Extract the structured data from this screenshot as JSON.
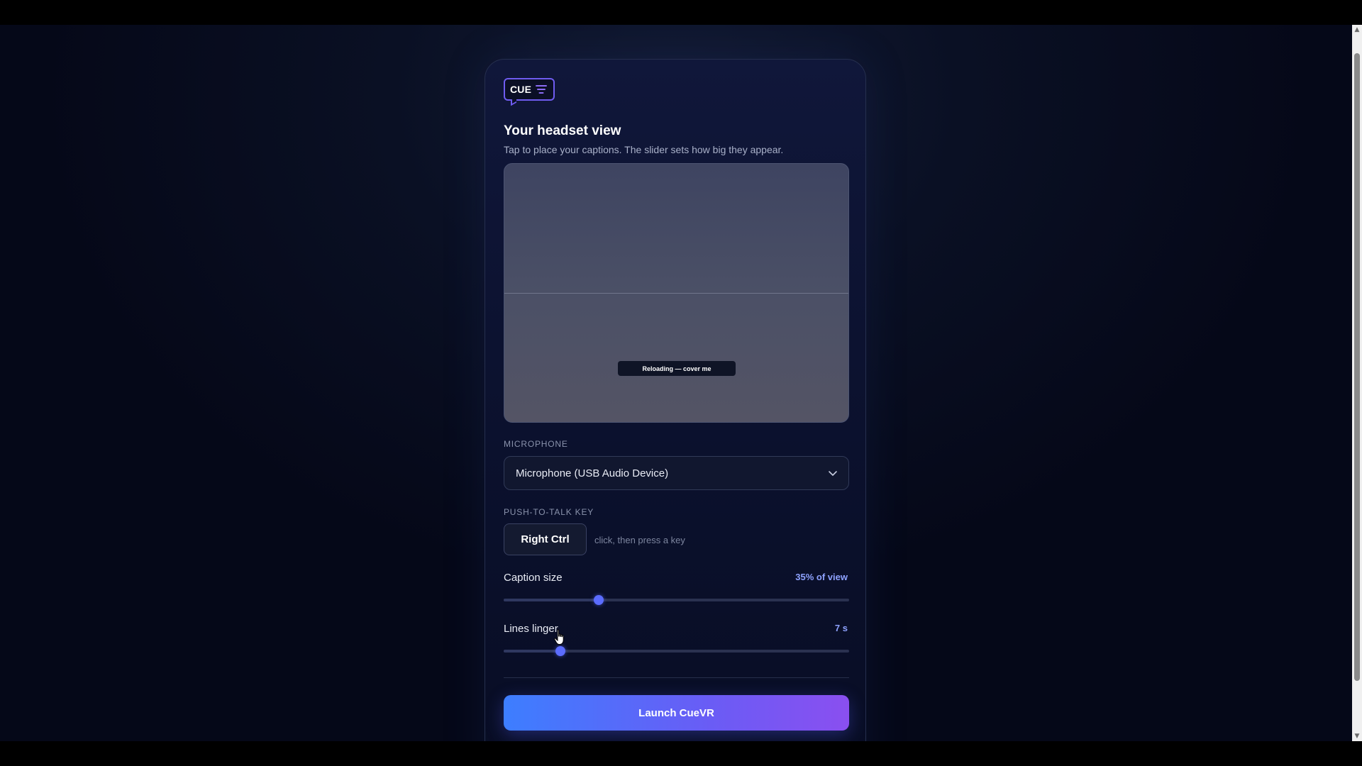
{
  "logo": {
    "text": "CUE",
    "icon": "caption-lines-icon",
    "border_color": "#6f5cf0"
  },
  "headset": {
    "title": "Your headset view",
    "subtitle": "Tap to place your captions. The slider sets how big they appear.",
    "caption_preview": "Reloading — cover me"
  },
  "microphone": {
    "label": "MICROPHONE",
    "selected": "Microphone (USB Audio Device)",
    "icon": "chevron-down-icon"
  },
  "push_to_talk": {
    "label": "PUSH-TO-TALK KEY",
    "key": "Right Ctrl",
    "hint": "click, then press a key"
  },
  "caption_size": {
    "label": "Caption size",
    "value_text": "35% of view",
    "slider_fraction": 0.275
  },
  "lines_linger": {
    "label": "Lines linger",
    "value_text": "7 s",
    "slider_fraction": 0.165
  },
  "launch": {
    "label": "Launch CueVR"
  },
  "colors": {
    "accent": "#8ea2ff",
    "slider_thumb": "#5b6cff",
    "launch_gradient_start": "#3d7eff",
    "launch_gradient_end": "#8a4ff0",
    "background": "#0a1024"
  },
  "scrollbar": {
    "up_icon": "scroll-up-arrow-icon",
    "down_icon": "scroll-down-arrow-icon"
  }
}
